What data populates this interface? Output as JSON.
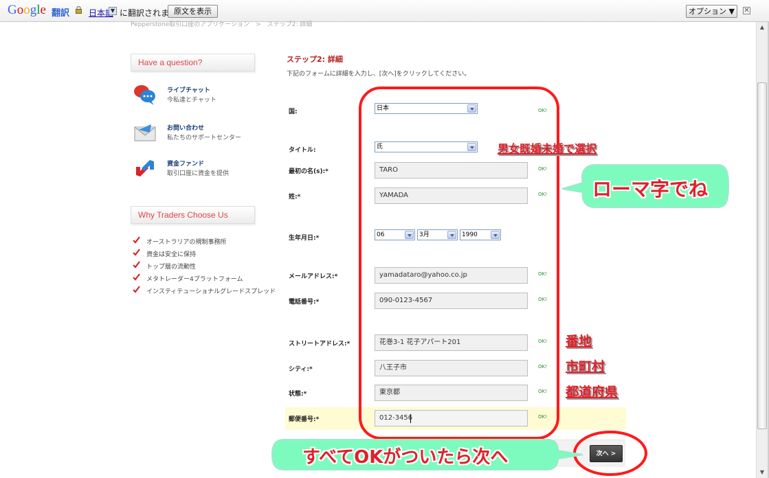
{
  "translate_bar": {
    "logo": "Google",
    "service": "翻訳",
    "language": "日本語",
    "translated_text": "に翻訳されました",
    "original_button": "原文を表示",
    "options_button": "オプション ▼",
    "close": "✕"
  },
  "breadcrumb": "Pepperstone取引口座のアプリケーション　>　ステップ2: 詳細",
  "sidebar": {
    "question_heading": "Have a question?",
    "items": [
      {
        "title": "ライブチャット",
        "subtitle": "今私達とチャット",
        "icon": "chat-bubbles-icon"
      },
      {
        "title": "お問い合わせ",
        "subtitle": "私たちのサポートセンター",
        "icon": "envelope-icon"
      },
      {
        "title": "資金ファンド",
        "subtitle": "取引口座に資金を提供",
        "icon": "transfer-arrows-icon"
      }
    ],
    "why_heading": "Why Traders Choose Us",
    "why_items": [
      "オーストラリアの規制事務所",
      "資金は安全に保持",
      "トップ層の流動性",
      "メタトレーダー4プラットフォーム",
      "インスティテューショナルグレードスプレッド"
    ]
  },
  "form": {
    "step_title": "ステップ2: 詳細",
    "description": "下記のフォームに詳細を入力し、[次へ]をクリックしてください。",
    "ok_label": "OK!",
    "fields": {
      "country": {
        "label": "国:",
        "value": "日本"
      },
      "title": {
        "label": "タイトル:",
        "value": "氏"
      },
      "first_name": {
        "label": "最初の名(s):*",
        "value": "TARO"
      },
      "last_name": {
        "label": "姓:*",
        "value": "YAMADA"
      },
      "birth": {
        "label": "生年月日:*",
        "day": "06",
        "month": "3月",
        "year": "1990"
      },
      "email": {
        "label": "メールアドレス:*",
        "value": "yamadataro@yahoo.co.jp"
      },
      "phone": {
        "label": "電話番号:*",
        "value": "090-0123-4567"
      },
      "street": {
        "label": "ストリートアドレス:*",
        "value": "花巻3-1 花子アパート201"
      },
      "city": {
        "label": "シティ:*",
        "value": "八王子市"
      },
      "state": {
        "label": "状態:*",
        "value": "東京都"
      },
      "postal": {
        "label": "郵便番号:*",
        "value": "012-3456"
      }
    },
    "next_button": "次へ >"
  },
  "annotations": {
    "select_note": "男女既婚未婚で選択",
    "romaji_note": "ローマ字でね",
    "banchi_note": "番地",
    "city_note": "市町村",
    "prefecture_note": "都道府県",
    "next_note": "すべてOKがついたら次へ"
  },
  "colors": {
    "annotation_red": "#e0202a",
    "bubble_green": "#7dfbbf",
    "step_title_red": "#b41e1e",
    "ok_green": "#2a8a2a",
    "postal_highlight": "#fffbd3"
  }
}
